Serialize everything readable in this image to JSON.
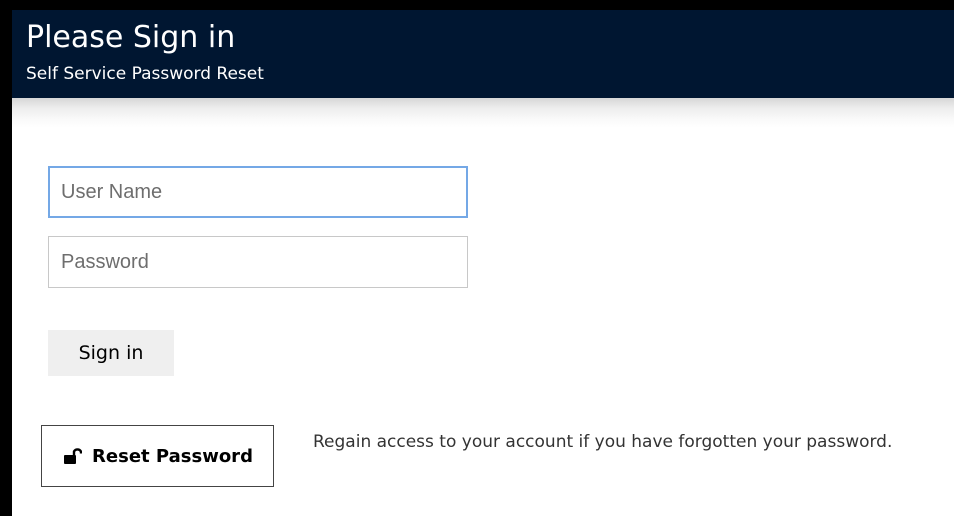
{
  "header": {
    "title": "Please Sign in",
    "subtitle": "Self Service Password Reset",
    "background_color": "#001631",
    "text_color": "#ffffff"
  },
  "login_form": {
    "username": {
      "placeholder": "User Name",
      "value": "",
      "focused": true,
      "focus_border_color": "#74a8e6"
    },
    "password": {
      "placeholder": "Password",
      "value": ""
    },
    "signin_button": {
      "label": "Sign in"
    }
  },
  "reset": {
    "button_label": "Reset Password",
    "button_icon": "unlocked-padlock-icon",
    "description": "Regain access to your account if you have forgotten your password."
  }
}
